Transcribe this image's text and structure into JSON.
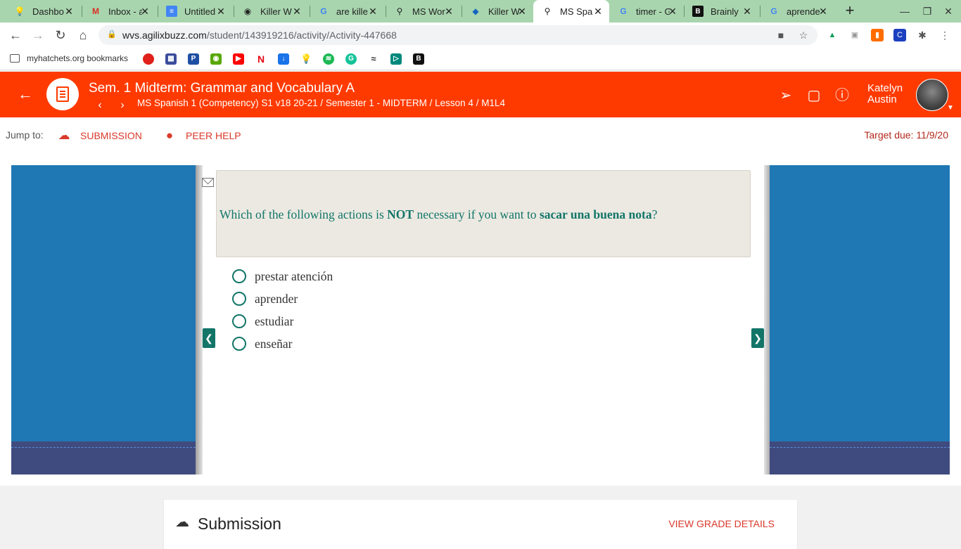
{
  "browser": {
    "tabs": [
      {
        "label": "Dashbo",
        "icon": "bulb-icon"
      },
      {
        "label": "Inbox - a",
        "icon": "gmail-icon"
      },
      {
        "label": "Untitled",
        "icon": "docs-icon"
      },
      {
        "label": "Killer W",
        "icon": "globe-icon"
      },
      {
        "label": "are kille",
        "icon": "google-icon"
      },
      {
        "label": "MS Wor",
        "icon": "bike-icon"
      },
      {
        "label": "Killer W",
        "icon": "noaa-icon"
      },
      {
        "label": "MS Spa",
        "icon": "bike-icon"
      },
      {
        "label": "timer - G",
        "icon": "google-icon"
      },
      {
        "label": "Brainly",
        "icon": "brainly-icon"
      },
      {
        "label": "aprende",
        "icon": "google-icon"
      }
    ],
    "active_tab_index": 7,
    "url_host": "wvs.agilixbuzz.com",
    "url_path": "/student/143919216/activity/Activity-447668",
    "bookmark_folder": "myhatchets.org bookmarks"
  },
  "app": {
    "title": "Sem. 1 Midterm: Grammar and Vocabulary A",
    "breadcrumb": "MS Spanish 1 (Competency) S1 v18 20-21 / Semester 1 - MIDTERM / Lesson 4 / M1L4",
    "user_first": "Katelyn",
    "user_last": "Austin",
    "accent_color": "#ff3a00"
  },
  "jump": {
    "label": "Jump to:",
    "submission": "SUBMISSION",
    "peer_help": "PEER HELP",
    "target_due": "Target due: 11/9/20"
  },
  "question": {
    "text_part1": "Which of the following actions is ",
    "text_bold1": "NOT",
    "text_part2": " necessary if you want to ",
    "text_bold2": "sacar una buena nota",
    "text_part3": "?",
    "choices": [
      "prestar atención",
      "aprender",
      "estudiar",
      "enseñar"
    ],
    "text_color": "#127568"
  },
  "submission": {
    "title": "Submission",
    "view_grade": "VIEW GRADE DETAILS"
  }
}
